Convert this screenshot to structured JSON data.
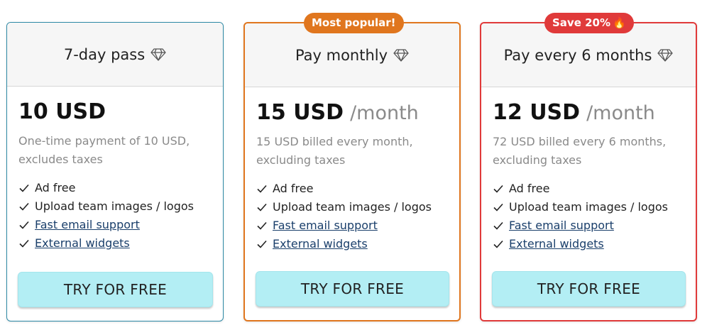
{
  "plans": [
    {
      "name": "7-day pass",
      "price": "10 USD",
      "period": "",
      "description": "One-time payment of 10 USD, excludes taxes",
      "features": [
        "Ad free",
        "Upload team images / logos",
        "Fast email support",
        "External widgets"
      ],
      "cta": "TRY FOR FREE",
      "border_color": "#2e8aa6"
    },
    {
      "name": "Pay monthly",
      "badge": "Most popular!",
      "badge_color": "#e0761e",
      "price": "15 USD",
      "period": "/month",
      "description": "15 USD billed every month, excluding taxes",
      "features": [
        "Ad free",
        "Upload team images / logos",
        "Fast email support",
        "External widgets"
      ],
      "cta": "TRY FOR FREE",
      "border_color": "#e0761e"
    },
    {
      "name": "Pay every 6 months",
      "badge": "Save 20%",
      "badge_icon": "fire-icon",
      "badge_color": "#e03a3a",
      "price": "12 USD",
      "period": "/month",
      "description": "72 USD billed every 6 months, excluding taxes",
      "features": [
        "Ad free",
        "Upload team images / logos",
        "Fast email support",
        "External widgets"
      ],
      "cta": "TRY FOR FREE",
      "border_color": "#e03a3a"
    }
  ],
  "icons": {
    "plan": "diamond-icon",
    "feature": "checkmark-icon"
  },
  "colors": {
    "button_bg": "#b3eef4",
    "link": "#1a3f6b",
    "muted_text": "#8a8a8a"
  }
}
